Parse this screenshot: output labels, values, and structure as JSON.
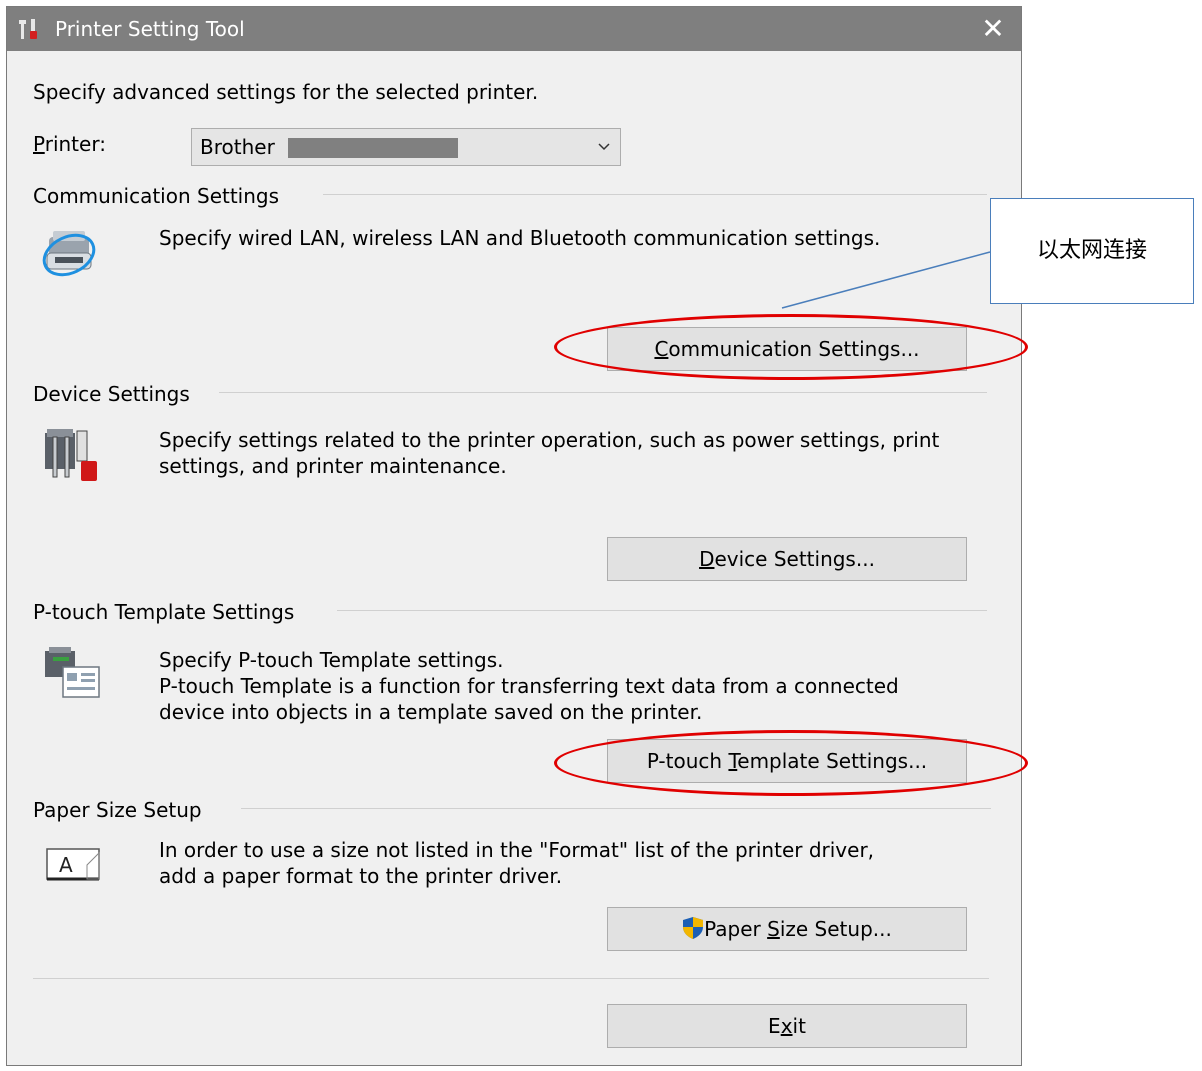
{
  "window": {
    "title": "Printer Setting Tool",
    "close_glyph": "✕",
    "title_icon": "tools-icon"
  },
  "intro": "Specify advanced settings for the selected printer.",
  "printer": {
    "label_accel": "P",
    "label_rest": "rinter:",
    "value": "Brother"
  },
  "communication": {
    "header": "Communication Settings",
    "description": "Specify wired LAN, wireless LAN and Bluetooth communication settings.",
    "button_accel": "C",
    "button_rest": "ommunication Settings...",
    "icon": "network-printer-icon"
  },
  "device": {
    "header": "Device Settings",
    "description_line1": "Specify settings related to the printer operation, such as power settings, print",
    "description_line2": "settings, and printer maintenance.",
    "button_accel": "D",
    "button_rest": "evice Settings...",
    "icon": "device-tools-icon"
  },
  "template": {
    "header": "P-touch Template Settings",
    "line1": "Specify P-touch Template settings.",
    "line2": "P-touch Template is a function for transferring text data from a connected",
    "line3": "device into objects in a template saved on the printer.",
    "button_pre": "P-touch ",
    "button_accel": "T",
    "button_rest": "emplate Settings...",
    "icon": "template-printer-icon"
  },
  "paper": {
    "header": "Paper Size Setup",
    "line1": "In order to use a size not listed in the \"Format\" list of the printer driver,",
    "line2": "add a paper format to the printer driver.",
    "button_pre": "Paper ",
    "button_accel": "S",
    "button_rest": "ize Setup...",
    "icon": "paper-size-icon",
    "button_icon": "uac-shield-icon"
  },
  "exit": {
    "pre": "E",
    "accel": "x",
    "rest": "it"
  },
  "annotation": {
    "callout_text": "以太网连接",
    "highlight_color": "#e00000",
    "callout_border_color": "#4a7ebb"
  }
}
